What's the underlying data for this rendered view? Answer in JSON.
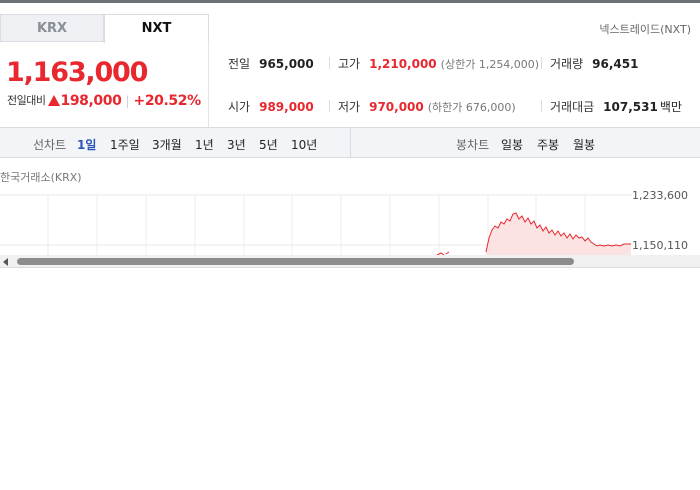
{
  "tabs": [
    {
      "label": "KRX",
      "active": false
    },
    {
      "label": "NXT",
      "active": true
    }
  ],
  "market_label": "넥스트레이드(NXT)",
  "price": {
    "current": "1,163,000",
    "change_label": "전일대비",
    "change": "198,000",
    "change_direction": "up",
    "change_percent": "+20.52%"
  },
  "stats": {
    "prev_close": {
      "label": "전일",
      "value": "965,000"
    },
    "high": {
      "label": "고가",
      "value": "1,210,000",
      "sub": "(상한가 1,254,000)"
    },
    "volume": {
      "label": "거래량",
      "value": "96,451"
    },
    "open": {
      "label": "시가",
      "value": "989,000"
    },
    "low": {
      "label": "저가",
      "value": "970,000",
      "sub": "(하한가 676,000)"
    },
    "trade_value": {
      "label": "거래대금",
      "value": "107,531",
      "unit": "백만"
    }
  },
  "line_chart_controls": {
    "label": "선차트",
    "periods": [
      "1일",
      "1주일",
      "3개월",
      "1년",
      "3년",
      "5년",
      "10년"
    ],
    "active_index": 0
  },
  "candle_chart_controls": {
    "label": "봉차트",
    "periods": [
      "일봉",
      "주봉",
      "월봉"
    ]
  },
  "exchange_label": "한국거래소(KRX)",
  "chart": {
    "y_ticks": [
      "1,233,600",
      "1,150,110"
    ],
    "line_color": "#e8272f",
    "fill_color": "#fbe3e3"
  },
  "colors": {
    "up": "#e8272f",
    "active_period": "#2a55b8"
  }
}
